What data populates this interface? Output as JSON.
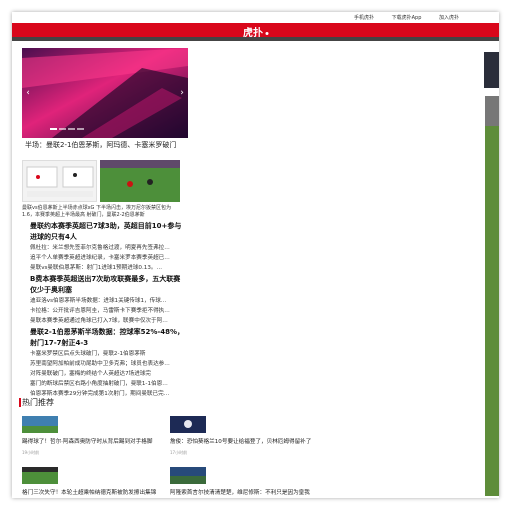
{
  "topbar": {
    "links": [
      "手机虎扑",
      "下载虎扑App",
      "加入虎扑"
    ]
  },
  "logo": {
    "text": "虎扑"
  },
  "hero": {
    "caption": "半场：曼联2-1伯恩茅斯，阿玛德、卡塞米罗破门",
    "prev_icon": "chevron-left-icon",
    "next_icon": "chevron-right-icon"
  },
  "thumbs": {
    "caption": "曼联vs伯恩茅斯上半场赤点球xG  下半场闪击，埃万尼尔扳禁区包为1.6，本赛季英超上半场最高    射破门，曼联2-2伯恩茅斯"
  },
  "articles": [
    {
      "title": "曼联约本赛季英超已7球3助，英超目前10+参与进球的只有4人",
      "lines": [
        "佩杜拉：米兰想先签菲尔克鲁格过渡，明夏再先签弗拉…",
        "追平个人单赛季英超进球纪录，卡塞米罗本赛季英超已…",
        "曼联vs曼联伯恩茅斯：射门1进球1预期进球0.13。…"
      ]
    },
    {
      "title": "B费本赛季英超送出7次助攻联赛最多，五大联赛仅少于奥利塞",
      "lines": [
        "迪亚洛vs伯恩茅斯半场数据：进球1关键传球1，传球…",
        "卡拉格：公开批评吉恩阿圭，马雷斯卡下赛季拒不得执…",
        "曼联本赛季英超通过角球已打入7球，联赛中仅次于阿…"
      ]
    },
    {
      "title": "曼联2-1伯恩茅斯半场数据：控球率52%-48%，射门17-7射正4-3",
      "lines": [
        "卡塞米罗禁区后点头球破门，曼联2-1伯恩茅斯",
        "苏里南望阿加帕前成功尾助中卫多克弗；球员也表达参…",
        "对阵曼联破门，塞梅的终结个人英超达7场进球完",
        "塞门的断球后禁区右路小角度抽射破门，曼联1-1伯恩…",
        "伯恩茅斯本赛季29分钟完成第1次射门，期间曼联已完…"
      ]
    }
  ],
  "hot": {
    "heading": "热门推荐",
    "items": [
      {
        "title": "踢得球了！哲尔·阿森西奥防守时从背后踢到对手格脚",
        "meta": "19小时前"
      },
      {
        "title": "詹俊：恐怕葵格兰10号要让给福登了，贝林厄姆得留补了",
        "meta": "17小时前"
      },
      {
        "title": "格门三次失守！本轮土超乘帕纳德克斯被防发擦出集锦",
        "meta": ""
      },
      {
        "title": "阿隆索首言尔技清清楚楚，维尼修斯：不利只是因为皇我",
        "meta": ""
      }
    ]
  },
  "colors": {
    "accent": "#d9071b",
    "hero_pink": "#e0237a",
    "hero_dark": "#2b0a3d",
    "pitch": "#4d8f3a"
  }
}
